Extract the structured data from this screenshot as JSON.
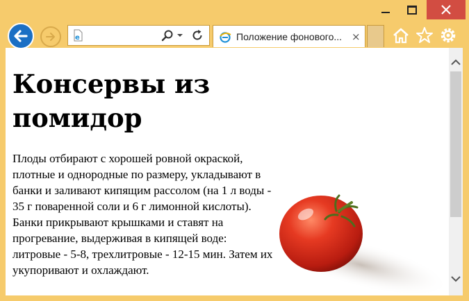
{
  "browser": {
    "address": {
      "value": "",
      "placeholder": ""
    },
    "tab": {
      "label": "Положение фонового...",
      "close_glyph": "×"
    }
  },
  "page": {
    "title": "Консервы из помидор",
    "body": "Плоды отбирают с хорошей ровной окраской, плотные и однородные по размеру, укладывают в банки и заливают кипящим рассолом (на 1 л воды - 35 г поваренной соли и 6 г лимонной кислоты). Банки прикрывают крышками и ставят на прогревание, выдерживая в кипящей воде: литровые - 5-8, трехлитровые - 12-15 мин. Затем их укупоривают и охлаждают."
  },
  "colors": {
    "frame": "#f6cb6c",
    "accent": "#1b6fc4",
    "close_button": "#d24d42",
    "tomato": "#d8281a"
  },
  "icons": [
    "back-arrow-icon",
    "forward-arrow-icon",
    "ie-page-icon",
    "search-icon",
    "dropdown-icon",
    "refresh-icon",
    "home-icon",
    "star-icon",
    "gear-icon",
    "scroll-up-icon",
    "scroll-down-icon"
  ]
}
